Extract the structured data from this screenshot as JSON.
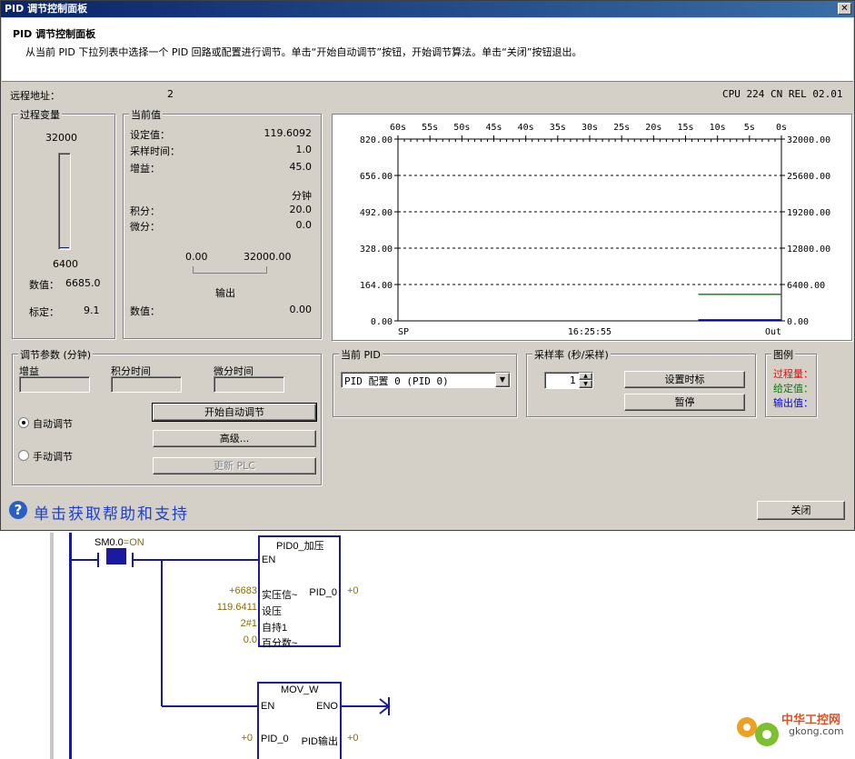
{
  "window": {
    "title": "PID 调节控制面板",
    "close_glyph": "✕"
  },
  "header": {
    "title": "PID 调节控制面板",
    "desc": "从当前 PID 下拉列表中选择一个 PID 回路或配置进行调节。单击“开始自动调节”按钮，开始调节算法。单击“关闭”按钮退出。"
  },
  "info": {
    "remote_label": "远程地址：",
    "remote_value": "2",
    "cpu": "CPU 224 CN REL 02.01"
  },
  "process_var": {
    "title": "过程变量",
    "top": "32000",
    "bottom": "6400",
    "value_label": "数值：",
    "value": "6685.0",
    "scale_label": "标定：",
    "scale": "9.1",
    "bar_level": 0.011
  },
  "current": {
    "title": "当前值",
    "setpoint_label": "设定值：",
    "setpoint": "119.6092",
    "sample_label": "采样时间：",
    "sample": "1.0",
    "gain_label": "增益：",
    "gain": "45.0",
    "unit": "分钟",
    "integral_label": "积分：",
    "integral": "20.0",
    "derivative_label": "微分：",
    "derivative": "0.0",
    "out_min": "0.00",
    "out_max": "32000.00",
    "out_label": "输出",
    "value_label": "数值：",
    "value": "0.00"
  },
  "chart_data": {
    "type": "line",
    "x_ticks": [
      "60s",
      "55s",
      "50s",
      "45s",
      "40s",
      "35s",
      "30s",
      "25s",
      "20s",
      "15s",
      "10s",
      "5s",
      "0s"
    ],
    "y_left_ticks": [
      "820.00",
      "656.00",
      "492.00",
      "328.00",
      "164.00",
      "0.00"
    ],
    "y_right_ticks": [
      "32000.00",
      "25600.00",
      "19200.00",
      "12800.00",
      "6400.00",
      "0.00"
    ],
    "bottom_left": "SP",
    "bottom_center": "16:25:55",
    "bottom_right": "Out",
    "ylim_left": [
      0,
      820
    ],
    "ylim_right": [
      0,
      32000
    ],
    "xlim": [
      60,
      0
    ],
    "grid": true,
    "series": [
      {
        "name": "过程量",
        "color": "#ff0000",
        "axis": "right",
        "x": [
          13,
          0
        ],
        "y": [
          200,
          200
        ]
      },
      {
        "name": "给定值",
        "color": "#008000",
        "axis": "left",
        "x": [
          13,
          0
        ],
        "y": [
          119.6,
          119.6
        ]
      },
      {
        "name": "输出值",
        "color": "#0000ff",
        "axis": "right",
        "x": [
          13,
          0
        ],
        "y": [
          0,
          0
        ]
      }
    ]
  },
  "tune": {
    "title": "调节参数 (分钟)",
    "gain_label": "增益",
    "integral_label": "积分时间",
    "derivative_label": "微分时间",
    "auto_label": "自动调节",
    "manual_label": "手动调节",
    "start_btn": "开始自动调节",
    "advanced_btn": "高级...",
    "update_btn": "更新 PLC"
  },
  "current_pid": {
    "title": "当前 PID",
    "selected": "PID 配置 0 (PID 0)"
  },
  "sample_rate": {
    "title": "采样率 (秒/采样)",
    "value": "1",
    "set_btn": "设置时标",
    "pause_btn": "暂停"
  },
  "legend": {
    "title": "图例",
    "items": [
      {
        "label": "过程量：",
        "color": "#ff0000"
      },
      {
        "label": "给定值：",
        "color": "#008000"
      },
      {
        "label": "输出值：",
        "color": "#0000ff"
      }
    ]
  },
  "footer": {
    "help": "单击获取帮助和支持",
    "close_btn": "关闭"
  },
  "ladder": {
    "contact_label": "SM0.0",
    "contact_state": "=ON",
    "pid_title": "PID0_加压",
    "pid_en": "EN",
    "pid_in1": "实压信~",
    "pid_in2": "设压",
    "pid_in3": "自持1",
    "pid_in4": "百分数~",
    "pid_out": "PID_0",
    "pid_v1": "+6683",
    "pid_v2": "119.6411",
    "pid_v3": "2#1",
    "pid_v4": "0.0",
    "pid_vout": "+0",
    "mov_title": "MOV_W",
    "mov_en": "EN",
    "mov_eno": "ENO",
    "mov_in": "PID_0",
    "mov_out": "PID输出",
    "mov_vin": "+0",
    "mov_vout": "+0"
  },
  "watermark": {
    "cn": "中华工控网",
    "url": "gkong.com"
  }
}
